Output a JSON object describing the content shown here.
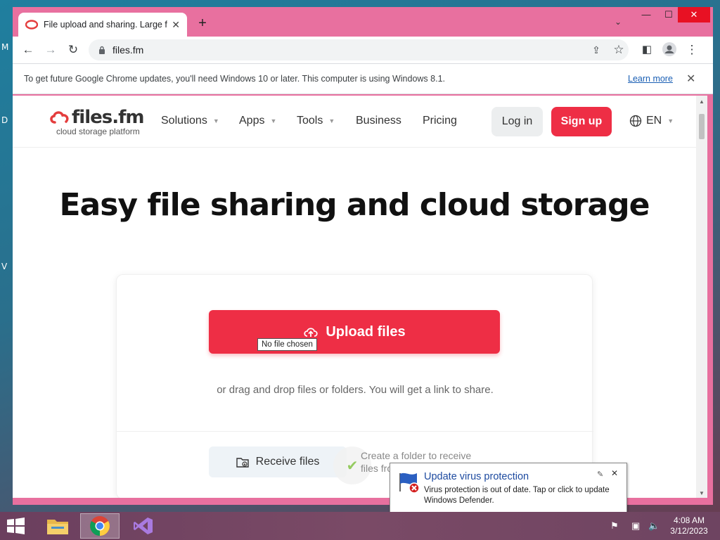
{
  "desktop": {
    "letters": [
      "M",
      "D",
      "V"
    ]
  },
  "browser": {
    "tab_title": "File upload and sharing. Large fil",
    "new_tab_label": "+",
    "url": "files.fm",
    "infobar_text": "To get future Google Chrome updates, you'll need Windows 10 or later. This computer is using Windows 8.1.",
    "infobar_link": "Learn more"
  },
  "site": {
    "logo_text": "files.fm",
    "logo_subtext": "cloud storage platform",
    "nav": [
      {
        "label": "Solutions",
        "dropdown": true
      },
      {
        "label": "Apps",
        "dropdown": true
      },
      {
        "label": "Tools",
        "dropdown": true
      },
      {
        "label": "Business",
        "dropdown": false
      },
      {
        "label": "Pricing",
        "dropdown": false
      }
    ],
    "login_label": "Log in",
    "signup_label": "Sign up",
    "language": "EN",
    "hero_title": "Easy file sharing and cloud storage",
    "upload_label": "Upload files",
    "file_tooltip": "No file chosen",
    "drag_text": "or drag and drop files or folders. You will get a link to share.",
    "receive_label": "Receive files",
    "receive_desc": "Create a folder to receive files from others"
  },
  "notification": {
    "title": "Update virus protection",
    "body": "Virus protection is out of date. Tap or click to update Windows Defender."
  },
  "clock": {
    "time": "4:08 AM",
    "date": "3/12/2023"
  },
  "colors": {
    "brand_red": "#ee2e45",
    "window_frame": "#e8709f",
    "link_blue": "#1a5fb4"
  }
}
